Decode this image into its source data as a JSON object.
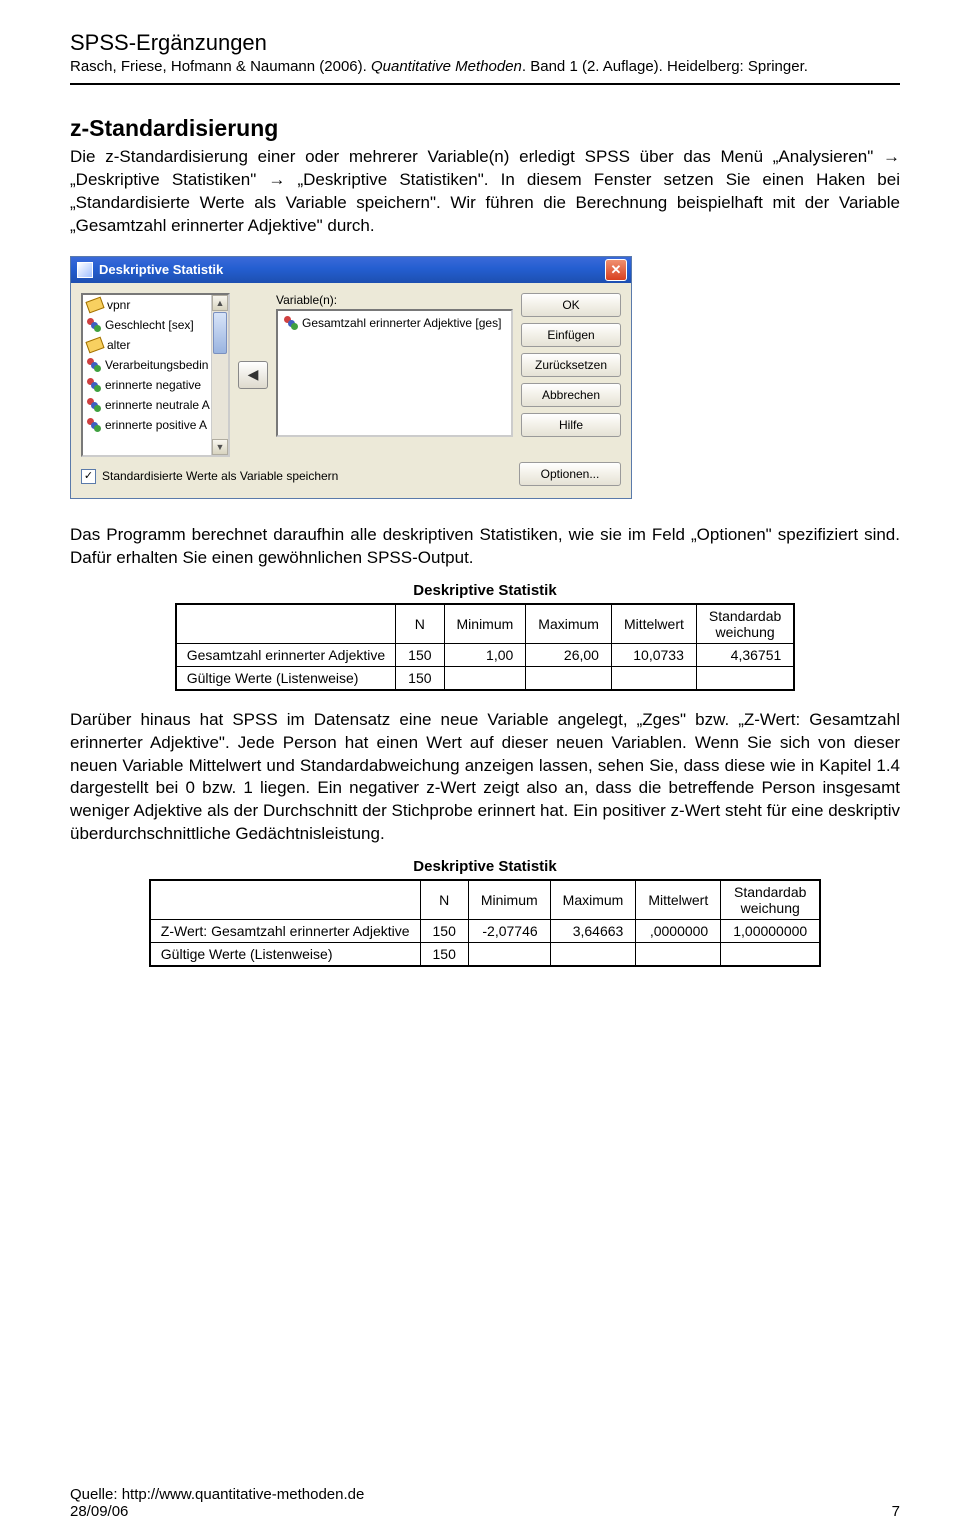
{
  "header": {
    "title": "SPSS-Ergänzungen",
    "cite_authors": "Rasch, Friese, Hofmann & Naumann (2006). ",
    "cite_italic": "Quantitative Methoden",
    "cite_tail": ". Band 1 (2. Auflage). Heidelberg: Springer."
  },
  "section_title": "z-Standardisierung",
  "para1": "Die z-Standardisierung einer oder mehrerer Variable(n) erledigt SPSS über das Menü „Analysieren\" → „Deskriptive Statistiken\" → „Deskriptive Statistiken\". In diesem Fenster setzen Sie einen Haken bei „Standardisierte Werte als Variable speichern\". Wir führen die Berechnung beispielhaft mit der Variable „Gesamtzahl erinnerter Adjektive\" durch.",
  "dialog": {
    "title": "Deskriptive Statistik",
    "source_vars": [
      "vpnr",
      "Geschlecht [sex]",
      "alter",
      "Verarbeitungsbedin",
      "erinnerte negative",
      "erinnerte neutrale A",
      "erinnerte positive A"
    ],
    "target_label": "Variable(n):",
    "target_vars": [
      "Gesamtzahl erinnerter Adjektive [ges]"
    ],
    "buttons": {
      "ok": "OK",
      "paste": "Einfügen",
      "reset": "Zurücksetzen",
      "cancel": "Abbrechen",
      "help": "Hilfe",
      "options": "Optionen..."
    },
    "checkbox_label": "Standardisierte Werte als Variable speichern",
    "checkbox_checked": true
  },
  "para2": "Das Programm berechnet daraufhin alle deskriptiven Statistiken, wie sie im Feld „Optionen\" spezifiziert sind. Dafür erhalten Sie einen gewöhnlichen SPSS-Output.",
  "tables": {
    "title": "Deskriptive Statistik",
    "cols": [
      "N",
      "Minimum",
      "Maximum",
      "Mittelwert"
    ],
    "sd_top": "Standardab",
    "sd_bot": "weichung",
    "t1": {
      "row1_label": "Gesamtzahl erinnerter Adjektive",
      "row1": [
        "150",
        "1,00",
        "26,00",
        "10,0733",
        "4,36751"
      ],
      "row2_label": "Gültige Werte (Listenweise)",
      "row2": [
        "150"
      ]
    },
    "t2": {
      "row1_label": "Z-Wert: Gesamtzahl erinnerter Adjektive",
      "row1": [
        "150",
        "-2,07746",
        "3,64663",
        ",0000000",
        "1,00000000"
      ],
      "row2_label": "Gültige Werte (Listenweise)",
      "row2": [
        "150"
      ]
    }
  },
  "para3": "Darüber hinaus hat SPSS im Datensatz eine neue Variable angelegt, „Zges\" bzw. „Z-Wert: Gesamtzahl erinnerter Adjektive\". Jede Person hat einen Wert auf dieser neuen Variablen. Wenn Sie sich von dieser neuen Variable Mittelwert und Standardabweichung anzeigen lassen, sehen Sie, dass diese wie in Kapitel 1.4 dargestellt bei 0 bzw. 1 liegen. Ein negativer z-Wert zeigt also an, dass die betreffende Person insgesamt weniger Adjektive als der Durchschnitt der Stichprobe erinnert hat. Ein positiver z-Wert steht für eine deskriptiv überdurchschnittliche Gedächtnisleistung.",
  "footer": {
    "source": "Quelle: http://www.quantitative-methoden.de",
    "date": "28/09/06",
    "page": "7"
  }
}
